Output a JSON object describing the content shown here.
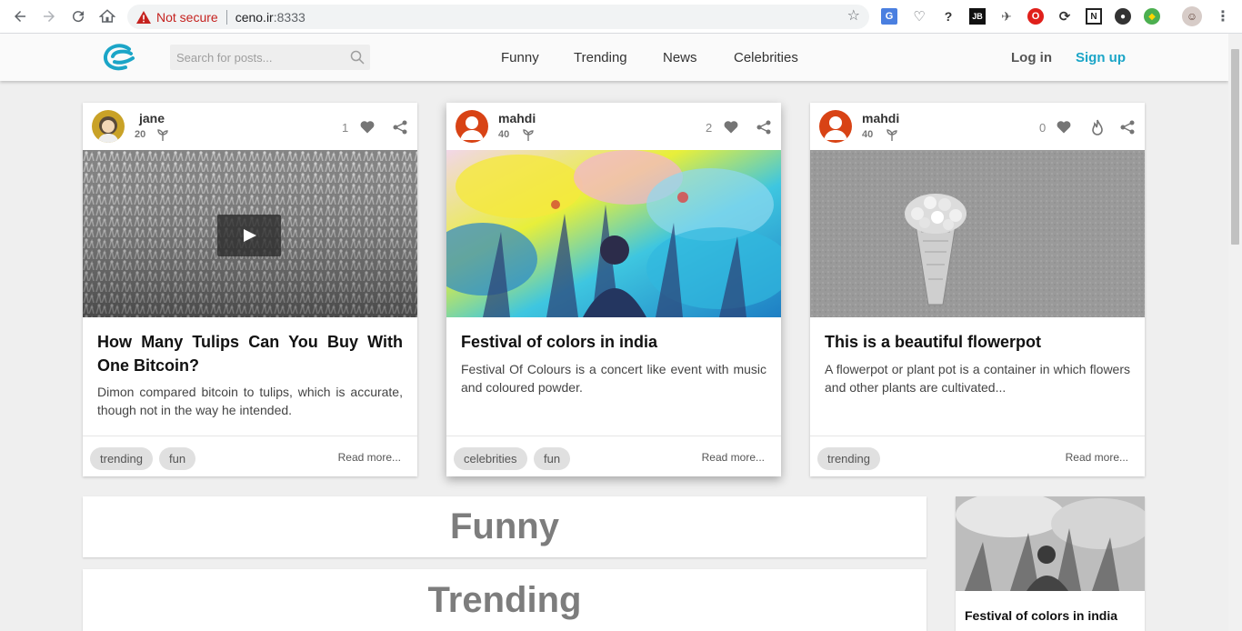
{
  "browser": {
    "security_label": "Not secure",
    "url_host": "ceno.ir",
    "url_port": ":8333"
  },
  "header": {
    "search_placeholder": "Search for posts...",
    "menu": [
      "Funny",
      "Trending",
      "News",
      "Celebrities"
    ],
    "login_label": "Log in",
    "signup_label": "Sign up",
    "brand_color": "#1ba5c7"
  },
  "posts": [
    {
      "username": "jane",
      "points": "20",
      "likes": "1",
      "title": "How Many Tulips Can You Buy With One Bitcoin?",
      "description": "Dimon compared bitcoin to tulips, which is accurate, though not in the way he intended.",
      "tags": [
        "trending",
        "fun"
      ],
      "read_more": "Read more...",
      "media": "video",
      "avatar_color": "#c9a227"
    },
    {
      "username": "mahdi",
      "points": "40",
      "likes": "2",
      "title": "Festival of colors in india",
      "description": "Festival Of Colours is a concert like event with music and coloured powder.",
      "tags": [
        "celebrities",
        "fun"
      ],
      "read_more": "Read more...",
      "media": "image",
      "avatar_color": "#d84315"
    },
    {
      "username": "mahdi",
      "points": "40",
      "likes": "0",
      "title": "This is a beautiful flowerpot",
      "description": "A flowerpot or plant pot is a container in which flowers and other plants are cultivated...",
      "tags": [
        "trending"
      ],
      "read_more": "Read more...",
      "media": "image",
      "avatar_color": "#d84315"
    }
  ],
  "sections": [
    "Funny",
    "Trending"
  ],
  "sidebar": {
    "featured_title": "Festival of colors in india"
  }
}
